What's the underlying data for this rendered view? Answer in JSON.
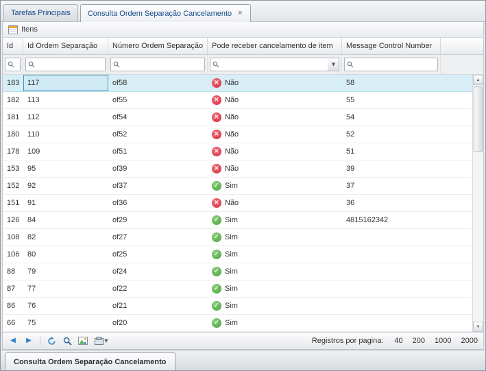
{
  "window": {
    "top_tabs": [
      {
        "label": "Tarefas Principais"
      },
      {
        "label": "Consulta Ordem Separação Cancelamento"
      }
    ],
    "bottom_tab_label": "Consulta Ordem Separação Cancelamento"
  },
  "toolbar": {
    "itens_label": "Itens"
  },
  "grid": {
    "columns": [
      {
        "label": "Id"
      },
      {
        "label": "Id Ordem Separação"
      },
      {
        "label": "Número Ordem Separação"
      },
      {
        "label": "Pode receber cancelamento de item"
      },
      {
        "label": "Message Control Number"
      }
    ],
    "rows": [
      {
        "id": "183",
        "id_ordem_separacao": "117",
        "numero_ordem_separacao": "of58",
        "pode_receber": "Não",
        "message_control_number": "58",
        "selected": true
      },
      {
        "id": "182",
        "id_ordem_separacao": "113",
        "numero_ordem_separacao": "of55",
        "pode_receber": "Não",
        "message_control_number": "55"
      },
      {
        "id": "181",
        "id_ordem_separacao": "112",
        "numero_ordem_separacao": "of54",
        "pode_receber": "Não",
        "message_control_number": "54"
      },
      {
        "id": "180",
        "id_ordem_separacao": "110",
        "numero_ordem_separacao": "of52",
        "pode_receber": "Não",
        "message_control_number": "52"
      },
      {
        "id": "178",
        "id_ordem_separacao": "109",
        "numero_ordem_separacao": "of51",
        "pode_receber": "Não",
        "message_control_number": "51"
      },
      {
        "id": "153",
        "id_ordem_separacao": "95",
        "numero_ordem_separacao": "of39",
        "pode_receber": "Não",
        "message_control_number": "39"
      },
      {
        "id": "152",
        "id_ordem_separacao": "92",
        "numero_ordem_separacao": "of37",
        "pode_receber": "Sim",
        "message_control_number": "37"
      },
      {
        "id": "151",
        "id_ordem_separacao": "91",
        "numero_ordem_separacao": "of36",
        "pode_receber": "Não",
        "message_control_number": "36"
      },
      {
        "id": "126",
        "id_ordem_separacao": "84",
        "numero_ordem_separacao": "of29",
        "pode_receber": "Sim",
        "message_control_number": "4815162342"
      },
      {
        "id": "108",
        "id_ordem_separacao": "82",
        "numero_ordem_separacao": "of27",
        "pode_receber": "Sim",
        "message_control_number": ""
      },
      {
        "id": "106",
        "id_ordem_separacao": "80",
        "numero_ordem_separacao": "of25",
        "pode_receber": "Sim",
        "message_control_number": ""
      },
      {
        "id": "88",
        "id_ordem_separacao": "79",
        "numero_ordem_separacao": "of24",
        "pode_receber": "Sim",
        "message_control_number": ""
      },
      {
        "id": "87",
        "id_ordem_separacao": "77",
        "numero_ordem_separacao": "of22",
        "pode_receber": "Sim",
        "message_control_number": ""
      },
      {
        "id": "86",
        "id_ordem_separacao": "76",
        "numero_ordem_separacao": "of21",
        "pode_receber": "Sim",
        "message_control_number": ""
      },
      {
        "id": "66",
        "id_ordem_separacao": "75",
        "numero_ordem_separacao": "of20",
        "pode_receber": "Sim",
        "message_control_number": ""
      }
    ]
  },
  "icons": {
    "sim_glyph": "✓",
    "nao_glyph": "×",
    "close_glyph": "×",
    "prev_glyph": "◀",
    "next_glyph": "▶",
    "up_glyph": "▲",
    "down_glyph": "▼",
    "caret_glyph": "▼"
  },
  "colors": {
    "tab_text": "#15498b",
    "selected_row": "#d7eef7",
    "nao_icon": "#d8293d",
    "sim_icon": "#45a339",
    "toolbar_icon_blue": "#2e7fc2"
  },
  "pagination": {
    "label": "Registros por pagina:",
    "options": [
      "40",
      "200",
      "1000",
      "2000"
    ]
  }
}
